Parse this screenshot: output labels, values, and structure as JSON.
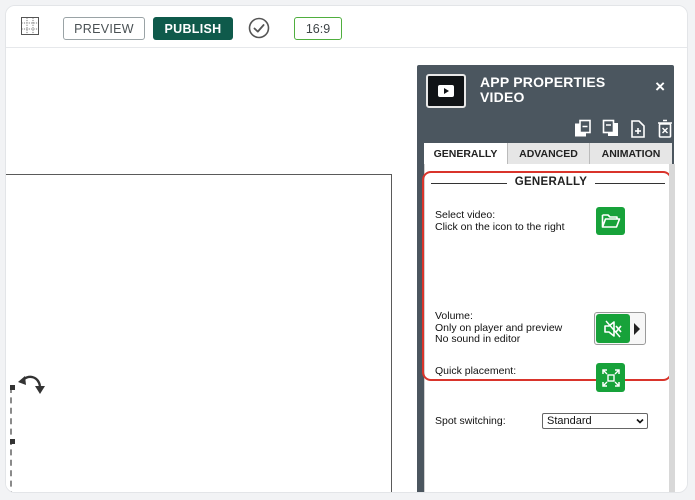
{
  "toolbar": {
    "grid_icon": "grid-icon",
    "preview_label": "PREVIEW",
    "publish_label": "PUBLISH",
    "check_icon": "check-circle-icon",
    "ratio_label": "16:9"
  },
  "panel": {
    "title_line1": "APP PROPERTIES",
    "title_line2": "VIDEO",
    "close_label": "×",
    "action_icons": [
      "copy-icon",
      "paste-icon",
      "duplicate-icon",
      "delete-icon"
    ],
    "tabs": [
      {
        "label": "GENERALLY",
        "active": true
      },
      {
        "label": "ADVANCED",
        "active": false
      },
      {
        "label": "ANIMATION",
        "active": false
      }
    ],
    "section_title": "GENERALLY",
    "select_video": {
      "line1": "Select video:",
      "line2": "Click on the icon to the right",
      "icon": "folder-open-icon"
    },
    "volume": {
      "line1": "Volume:",
      "line2": "Only on player and preview",
      "line3": "No sound in editor",
      "icon": "muted-speaker-icon"
    },
    "quick_placement": {
      "label": "Quick placement:",
      "icon": "expand-icon"
    },
    "spot_switching": {
      "label": "Spot switching:",
      "value": "Standard"
    }
  },
  "colors": {
    "publish_bg": "#0f5a4b",
    "ratio_border": "#4fae3e",
    "panel_bg": "#4b565f",
    "highlight": "#d9342b",
    "action_green": "#17a23a"
  }
}
